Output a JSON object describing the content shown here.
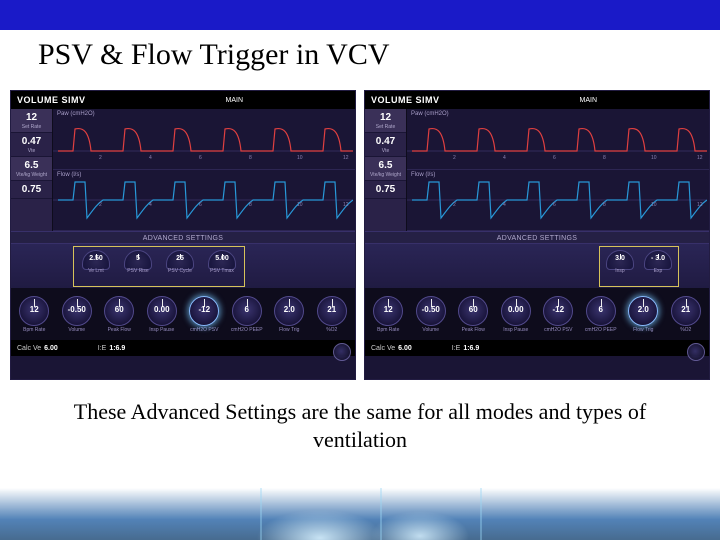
{
  "title": "PSV & Flow Trigger in VCV",
  "caption": "These Advanced Settings are the same for all modes and types of ventilation",
  "panel_common": {
    "mode_label": "VOLUME SIMV",
    "main_tab": "MAIN",
    "adv_header": "ADVANCED SETTINGS",
    "sidebar": [
      {
        "val": "12",
        "lbl": "Set Rate"
      },
      {
        "val": "0.47",
        "lbl": "Vte"
      },
      {
        "val": "6.5",
        "lbl": "Vte/kg Weight"
      },
      {
        "val": "0.75",
        "lbl": ""
      }
    ],
    "chart_labels": {
      "top": "Paw (cmH2O)",
      "bottom": "Flow (l/s)"
    },
    "dials": [
      {
        "val": "12",
        "lbl": "Bpm Rate"
      },
      {
        "val": "-0.50",
        "lbl": "Volume"
      },
      {
        "val": "60",
        "lbl": "Peak Flow"
      },
      {
        "val": "0.00",
        "lbl": "Insp Pause"
      },
      {
        "val": "-12",
        "lbl": "cmH2O PSV"
      },
      {
        "val": "6",
        "lbl": "cmH2O PEEP"
      },
      {
        "val": "2.0",
        "lbl": "Flow Trig"
      },
      {
        "val": "21",
        "lbl": "%O2"
      }
    ],
    "footer": {
      "calcVe_lbl": "Calc Ve",
      "calcVe": "6.00",
      "ie_lbl": "I:E",
      "ie": "1:6.9"
    }
  },
  "panels": {
    "left": {
      "adv_dials": [
        {
          "val": "2.50",
          "lbl": "Ve Lmt"
        },
        {
          "val": "5",
          "lbl": "PSV Rise"
        },
        {
          "val": "25",
          "lbl": "PSV Cycle"
        },
        {
          "val": "5.00",
          "lbl": "PSV Tmax"
        }
      ],
      "highlight_dial_index": 4
    },
    "right": {
      "adv_dials": [
        {
          "val": "3.0",
          "lbl": "Insp"
        },
        {
          "val": "- 3.0",
          "lbl": "Exp"
        }
      ],
      "highlight_dial_index": 6
    }
  },
  "chart_data": [
    {
      "type": "line",
      "title": "Paw (cmH2O)",
      "ylim": [
        -20,
        60
      ],
      "xlim": [
        0,
        12
      ],
      "gridx": [
        2,
        4,
        6,
        8,
        10,
        12
      ],
      "series": [
        {
          "name": "Paw",
          "color": "#e04040"
        }
      ]
    },
    {
      "type": "line",
      "title": "Flow (l/s)",
      "ylim": [
        -60,
        60
      ],
      "xlim": [
        0,
        12
      ],
      "gridx": [
        2,
        4,
        6,
        8,
        10,
        12
      ],
      "series": [
        {
          "name": "Flow",
          "color": "#2898d8"
        }
      ]
    }
  ]
}
